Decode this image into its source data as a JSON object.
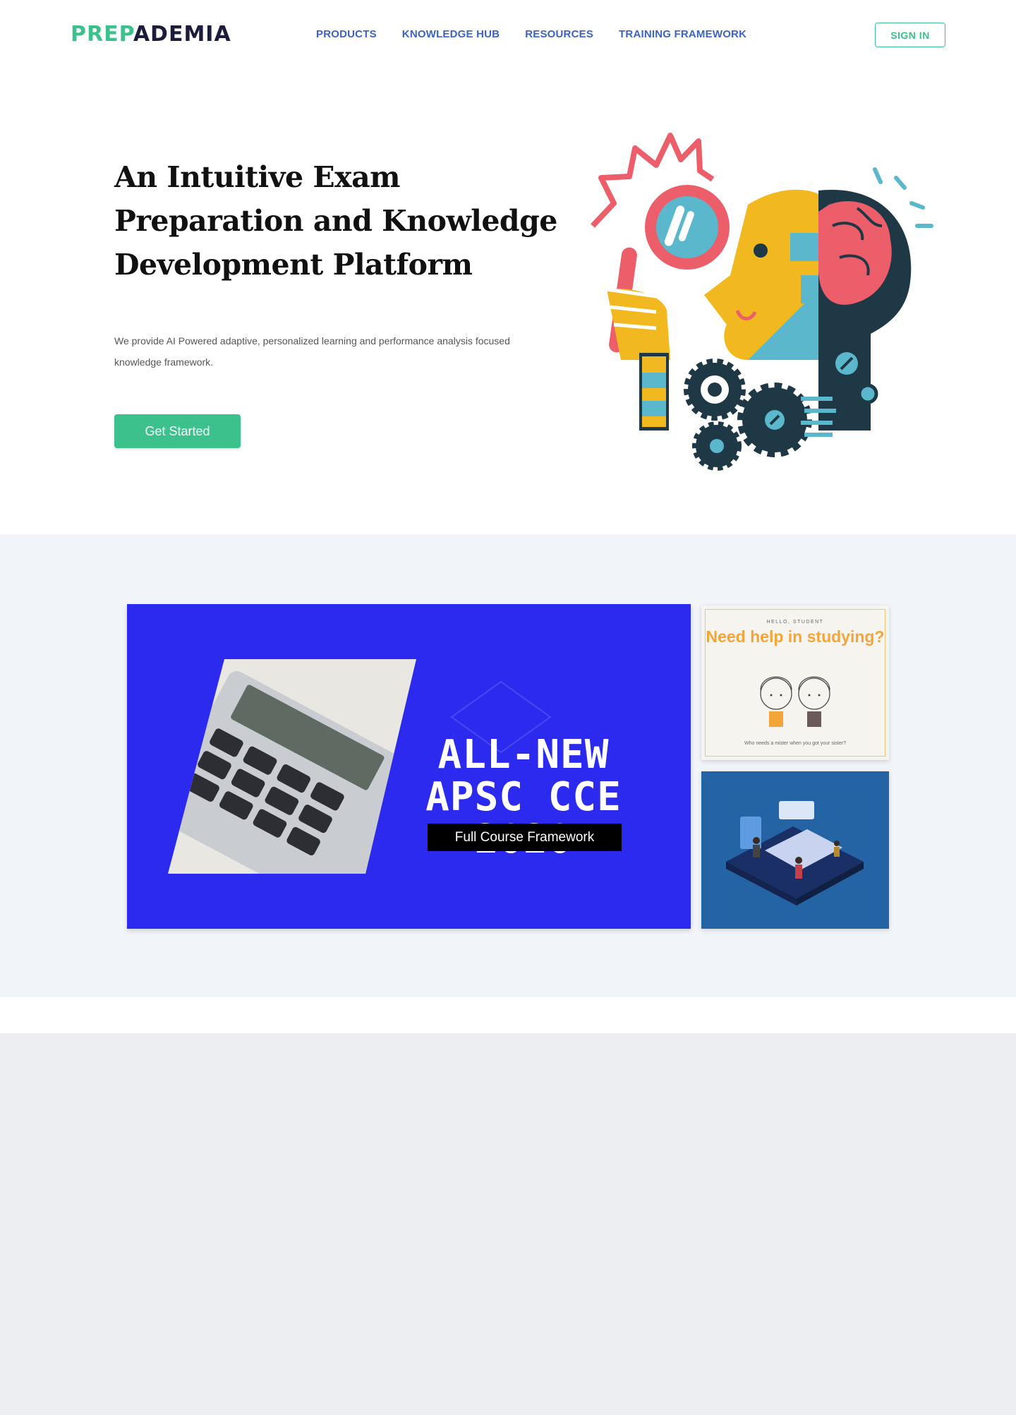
{
  "brand": {
    "part1": "PREP",
    "part2": "ADEMIA"
  },
  "nav": {
    "items": [
      {
        "label": "PRODUCTS"
      },
      {
        "label": "KNOWLEDGE HUB"
      },
      {
        "label": "RESOURCES"
      },
      {
        "label": "TRAINING FRAMEWORK"
      }
    ],
    "signin_label": "SIGN IN"
  },
  "hero": {
    "title": "An Intuitive Exam Preparation and Knowledge Development Platform",
    "subtitle": "We provide AI Powered adaptive, personalized learning and performance analysis focused knowledge framework.",
    "cta_label": "Get Started"
  },
  "promo": {
    "main_title": "ALL-NEW APSC CCE 2020",
    "main_tag": "Full Course Framework",
    "card_kicker": "HELLO, STUDENT",
    "card_title": "Need help in studying?",
    "card_footer": "Who needs a mister when you got your sister?"
  },
  "colors": {
    "accent_green": "#3cc18c",
    "nav_blue": "#3b63c4",
    "promo_blue": "#2c2aee",
    "card_blue": "#2463a4",
    "band_bg": "#f1f4f8"
  }
}
